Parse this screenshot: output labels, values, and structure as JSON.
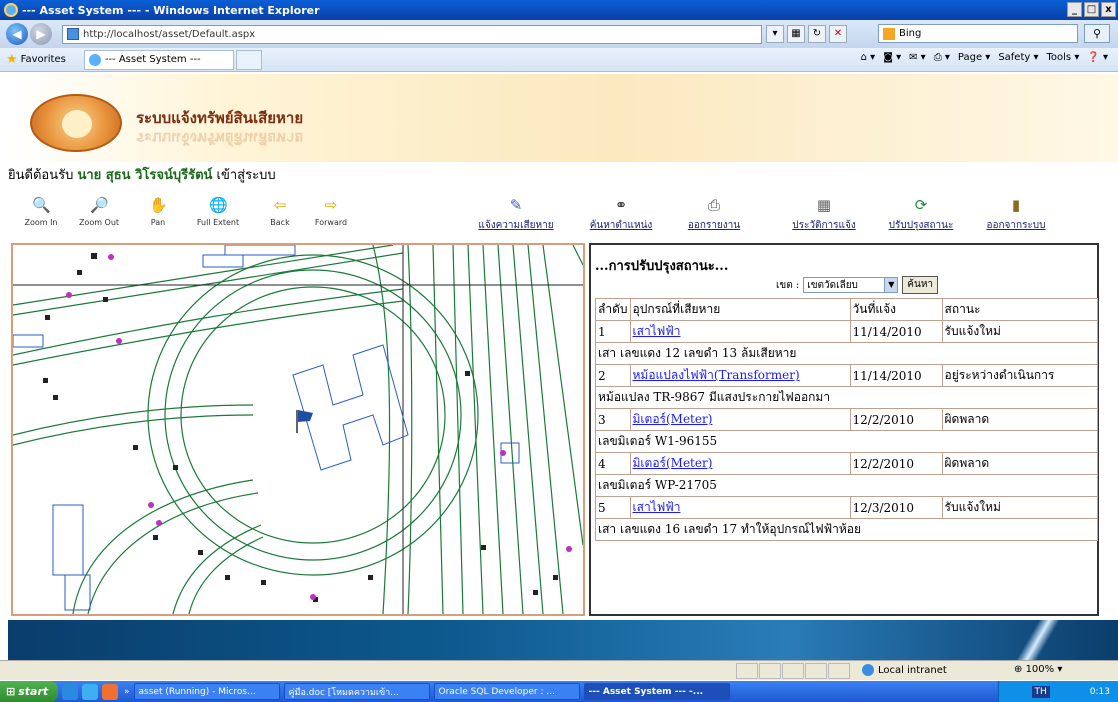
{
  "window": {
    "title": "--- Asset System --- - Windows Internet Explorer",
    "buttons": [
      "_",
      "□",
      "x"
    ]
  },
  "address": {
    "url": "http://localhost/asset/Default.aspx",
    "search_value": "Bing"
  },
  "favorites": {
    "label": "Favorites",
    "tab": "--- Asset System ---",
    "commands": [
      "Page ▾",
      "Safety ▾",
      "Tools ▾"
    ]
  },
  "banner": {
    "title": "ระบบแจ้งทรัพย์สินเสียหาย"
  },
  "welcome": {
    "prefix": "ยินดีต้อนรับ",
    "name": "นาย สุธน  วิโรจน์บุรีรัตน์",
    "login": "เข้าสู่ระบบ"
  },
  "toolbar": {
    "map_tools": [
      {
        "label": "Zoom In",
        "icon": "zoom-in-icon"
      },
      {
        "label": "Zoom Out",
        "icon": "zoom-out-icon"
      },
      {
        "label": "Pan",
        "icon": "pan-hand-icon"
      },
      {
        "label": "Full Extent",
        "icon": "globe-icon"
      },
      {
        "label": "Back",
        "icon": "arrow-left-icon"
      },
      {
        "label": "Forward",
        "icon": "arrow-right-icon"
      }
    ],
    "links": [
      {
        "label": "แจ้งความเสียหาย",
        "icon": "edit-pencil-icon"
      },
      {
        "label": "ค้นหาตำแหน่ง",
        "icon": "binoculars-icon"
      },
      {
        "label": "ออกรายงาน",
        "icon": "printer-icon"
      },
      {
        "label": "ประวัติการแจ้ง",
        "icon": "calendar-icon"
      },
      {
        "label": "ปรับปรุงสถานะ",
        "icon": "refresh-icon"
      },
      {
        "label": "ออกจากระบบ",
        "icon": "exit-door-icon"
      }
    ]
  },
  "panel": {
    "title": "...การปรับปรุงสถานะ...",
    "zone_label": "เขต :",
    "zone_value": "เขตวัดเลียบ",
    "search_button": "ค้นหา",
    "columns": [
      "ลำดับ",
      "อุปกรณ์ที่เสียหาย",
      "วันที่แจ้ง",
      "สถานะ"
    ],
    "rows": [
      {
        "no": "1",
        "equipment": "เสาไฟฟ้า",
        "date": "11/14/2010",
        "status": "รับแจ้งใหม่",
        "detail": "เสา เลขแดง 12 เลขดำ 13 ล้มเสียหาย"
      },
      {
        "no": "2",
        "equipment": "หม้อแปลงไฟฟ้า(Transformer)",
        "date": "11/14/2010",
        "status": "อยู่ระหว่างดำเนินการ",
        "detail": "หม้อแปลง TR-9867 มีแสงประกายไฟออกมา"
      },
      {
        "no": "3",
        "equipment": "มิเตอร์(Meter)",
        "date": "12/2/2010",
        "status": "ผิดพลาด",
        "detail": "เลขมิเตอร์ W1-96155"
      },
      {
        "no": "4",
        "equipment": "มิเตอร์(Meter)",
        "date": "12/2/2010",
        "status": "ผิดพลาด",
        "detail": "เลขมิเตอร์ WP-21705"
      },
      {
        "no": "5",
        "equipment": "เสาไฟฟ้า",
        "date": "12/3/2010",
        "status": "รับแจ้งใหม่",
        "detail": "เสา เลขแดง 16 เลขดำ 17 ทำให้อุปกรณ์ไฟฟ้าห้อย"
      }
    ]
  },
  "statusbar": {
    "zone": "Local intranet",
    "zoom": "100%"
  },
  "taskbar": {
    "start": "start",
    "buttons": [
      {
        "label": "asset (Running) - Micros..."
      },
      {
        "label": "คู่มือ.doc [โหมดความเข้า..."
      },
      {
        "label": "Oracle SQL Developer : ..."
      },
      {
        "label": "--- Asset System --- -..."
      }
    ],
    "lang": "TH",
    "clock": "0:13"
  },
  "colors": {
    "titlebar": "#0a4fc2",
    "map_border": "#d89d7a",
    "map_lines": "#1b7a3a",
    "link": "#1a237e"
  }
}
